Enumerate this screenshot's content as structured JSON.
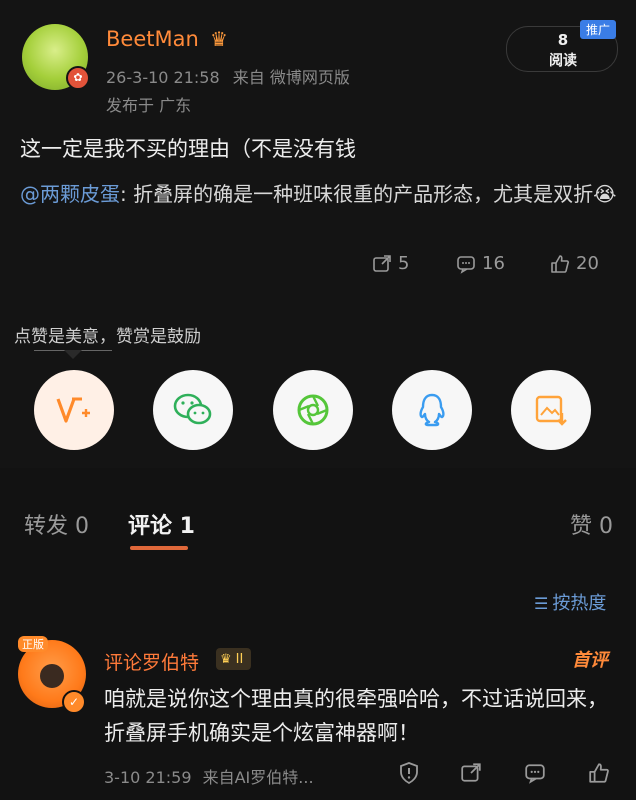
{
  "post": {
    "username": "BeetMan",
    "time": "26-3-10 21:58",
    "source": "来自 微博网页版",
    "location": "发布于 广东",
    "read_count": "8",
    "read_label": "阅读",
    "ad_tag": "推广",
    "text": "这一定是我不买的理由（不是没有钱",
    "quote_mention": "@两颗皮蛋",
    "quote_text": ": 折叠屏的确是一种班味很重的产品形态，尤其是双折",
    "quote_emoji": "😭",
    "repost_count": "5",
    "comment_count": "16",
    "like_count": "20"
  },
  "tip": {
    "label": "点赞是美意，赞赏是鼓励",
    "share_targets": [
      {
        "name": "vip-reward",
        "color": "#ff8a2a"
      },
      {
        "name": "wechat",
        "color": "#2fb05a"
      },
      {
        "name": "moments",
        "color": "#55c63a"
      },
      {
        "name": "qq",
        "color": "#3a9cf0"
      },
      {
        "name": "save-image",
        "color": "#ffa33a"
      }
    ]
  },
  "tabs": {
    "repost": "转发 0",
    "comment": "评论 1",
    "like": "赞 0"
  },
  "sort_label": "按热度",
  "comment": {
    "avatar_tag": "正版",
    "username": "评论罗伯特",
    "level": "II",
    "first_badge": "首评",
    "text": "咱就是说你这个理由真的很牵强哈哈，不过话说回来，折叠屏手机确实是个炫富神器啊！",
    "time": "3-10 21:59",
    "source": "来自AI罗伯特..."
  },
  "colors": {
    "accent": "#ff8a3a",
    "link": "#6b9bd6",
    "tab_indicator": "#e0683a"
  }
}
